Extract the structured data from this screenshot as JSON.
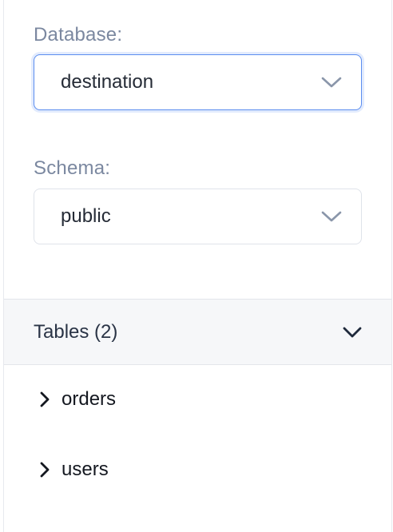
{
  "database": {
    "label": "Database:",
    "value": "destination",
    "icon": "chevron-down-icon"
  },
  "schema": {
    "label": "Schema:",
    "value": "public",
    "icon": "chevron-down-icon"
  },
  "tables": {
    "title": "Tables (2)",
    "expanded": true,
    "icon": "chevron-down-icon",
    "items": [
      {
        "label": "orders",
        "icon": "chevron-right-icon"
      },
      {
        "label": "users",
        "icon": "chevron-right-icon"
      }
    ]
  },
  "colors": {
    "label": "#7b88a0",
    "focus_border": "#5b8def",
    "chevron": "#8a96aa",
    "header_bg": "#f6f7f9"
  }
}
